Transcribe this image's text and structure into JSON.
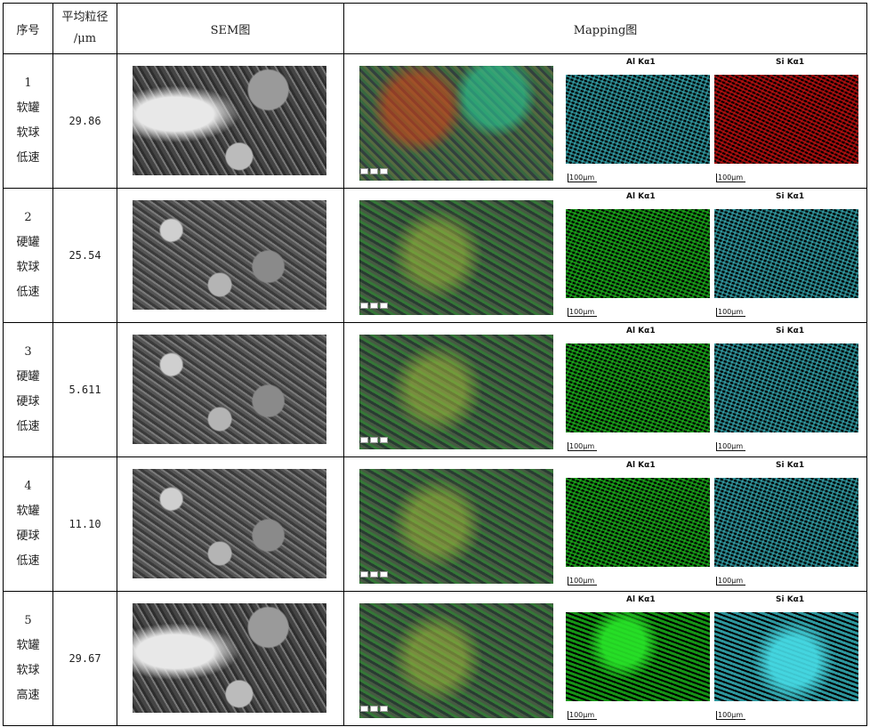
{
  "header": {
    "seq": "序号",
    "size_line1": "平均粒径",
    "size_line2": "/μm",
    "sem": "SEM图",
    "mapping": "Mapping图"
  },
  "map_labels": {
    "al": "Al Kα1",
    "si": "Si Kα1"
  },
  "scale_bar": "100μm",
  "rows": [
    {
      "num": "1",
      "jar": "软罐",
      "ball": "软球",
      "speed": "低速",
      "size": "29.86",
      "al_color": "cyan",
      "si_color": "red"
    },
    {
      "num": "2",
      "jar": "硬罐",
      "ball": "软球",
      "speed": "低速",
      "size": "25.54",
      "al_color": "green",
      "si_color": "cyan"
    },
    {
      "num": "3",
      "jar": "硬罐",
      "ball": "硬球",
      "speed": "低速",
      "size": "5.611",
      "al_color": "green",
      "si_color": "cyan"
    },
    {
      "num": "4",
      "jar": "软罐",
      "ball": "硬球",
      "speed": "低速",
      "size": "11.10",
      "al_color": "green",
      "si_color": "cyan"
    },
    {
      "num": "5",
      "jar": "软罐",
      "ball": "软球",
      "speed": "高速",
      "size": "29.67",
      "al_color": "green",
      "si_color": "cyan"
    }
  ],
  "colors": {
    "border": "#000000",
    "cyan": "#40c8d2",
    "green": "#20c820",
    "red": "#d21414"
  }
}
